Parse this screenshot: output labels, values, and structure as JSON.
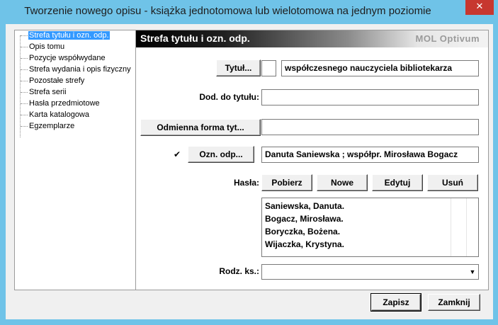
{
  "window": {
    "title": "Tworzenie nowego opisu - książka jednotomowa lub wielotomowa na jednym poziomie",
    "close_label": "✕"
  },
  "tree": {
    "items": [
      {
        "label": "Strefa tytułu i ozn. odp.",
        "selected": true
      },
      {
        "label": "Opis tomu"
      },
      {
        "label": "Pozycje współwydane"
      },
      {
        "label": "Strefa wydania i opis fizyczny"
      },
      {
        "label": "Pozostałe strefy"
      },
      {
        "label": "Strefa serii"
      },
      {
        "label": "Hasła przedmiotowe"
      },
      {
        "label": "Karta katalogowa"
      },
      {
        "label": "Egzemplarze"
      }
    ]
  },
  "panel": {
    "title": "Strefa tytułu i ozn. odp.",
    "brand": "MOL Optivum"
  },
  "form": {
    "tytul_button": "Tytuł...",
    "tytul_small_value": "",
    "tytul_value": "współczesnego nauczyciela bibliotekarza",
    "dod_label": "Dod. do tytułu:",
    "dod_value": "",
    "odmienna_button": "Odmienna forma tyt...",
    "odmienna_value": "",
    "ozn_checked": "✔",
    "ozn_button": "Ozn. odp...",
    "ozn_value": "Danuta Saniewska ; współpr. Mirosława Bogacz",
    "hasla_label": "Hasła:",
    "pobierz": "Pobierz",
    "nowe": "Nowe",
    "edytuj": "Edytuj",
    "usun": "Usuń",
    "hasla_list": [
      "Saniewska, Danuta.",
      "Bogacz, Mirosława.",
      "Boryczka, Bożena.",
      "Wijaczka, Krystyna."
    ],
    "rodz_label": "Rodz. ks.:",
    "rodz_value": "",
    "dropdown_icon": "▼"
  },
  "footer": {
    "zapisz": "Zapisz",
    "zamknij": "Zamknij"
  }
}
